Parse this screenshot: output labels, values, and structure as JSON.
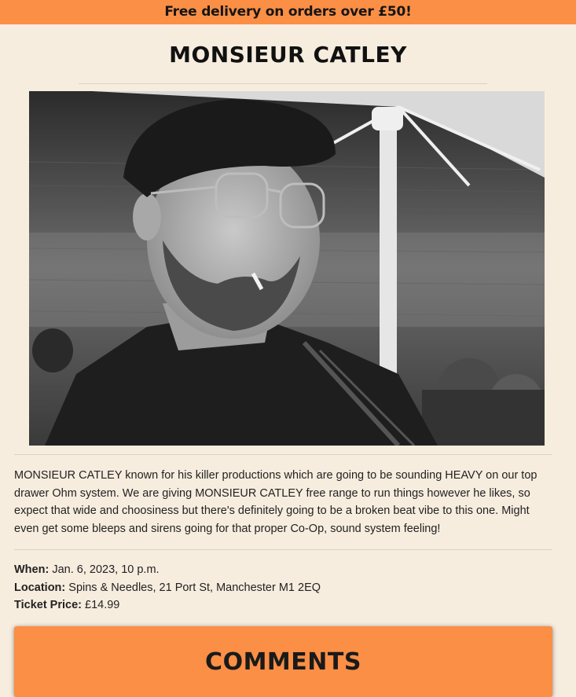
{
  "banner": {
    "text": "Free delivery on orders over £50!"
  },
  "event": {
    "title": "MONSIEUR CATLEY",
    "photo_icon": "event-photo",
    "description": "MONSIEUR CATLEY known for his killer productions which are going to be sounding HEAVY on our top drawer Ohm system. We are giving MONSIEUR CATLEY free range to run things however he likes, so expect that wide and choosiness but there's definitely going to be a broken beat vibe to this one. Might even get some bleeps and sirens going for that proper Co-Op, sound system feeling!",
    "details": {
      "when_label": "When:",
      "when_value": " Jan. 6, 2023, 10 p.m.",
      "location_label": "Location:",
      "location_value": " Spins & Needles, 21 Port St, Manchester M1 2EQ",
      "price_label": "Ticket Price:",
      "price_value": " £14.99"
    }
  },
  "comments": {
    "heading": "COMMENTS"
  },
  "colors": {
    "accent": "#fa8f45",
    "background": "#f7eddf"
  }
}
